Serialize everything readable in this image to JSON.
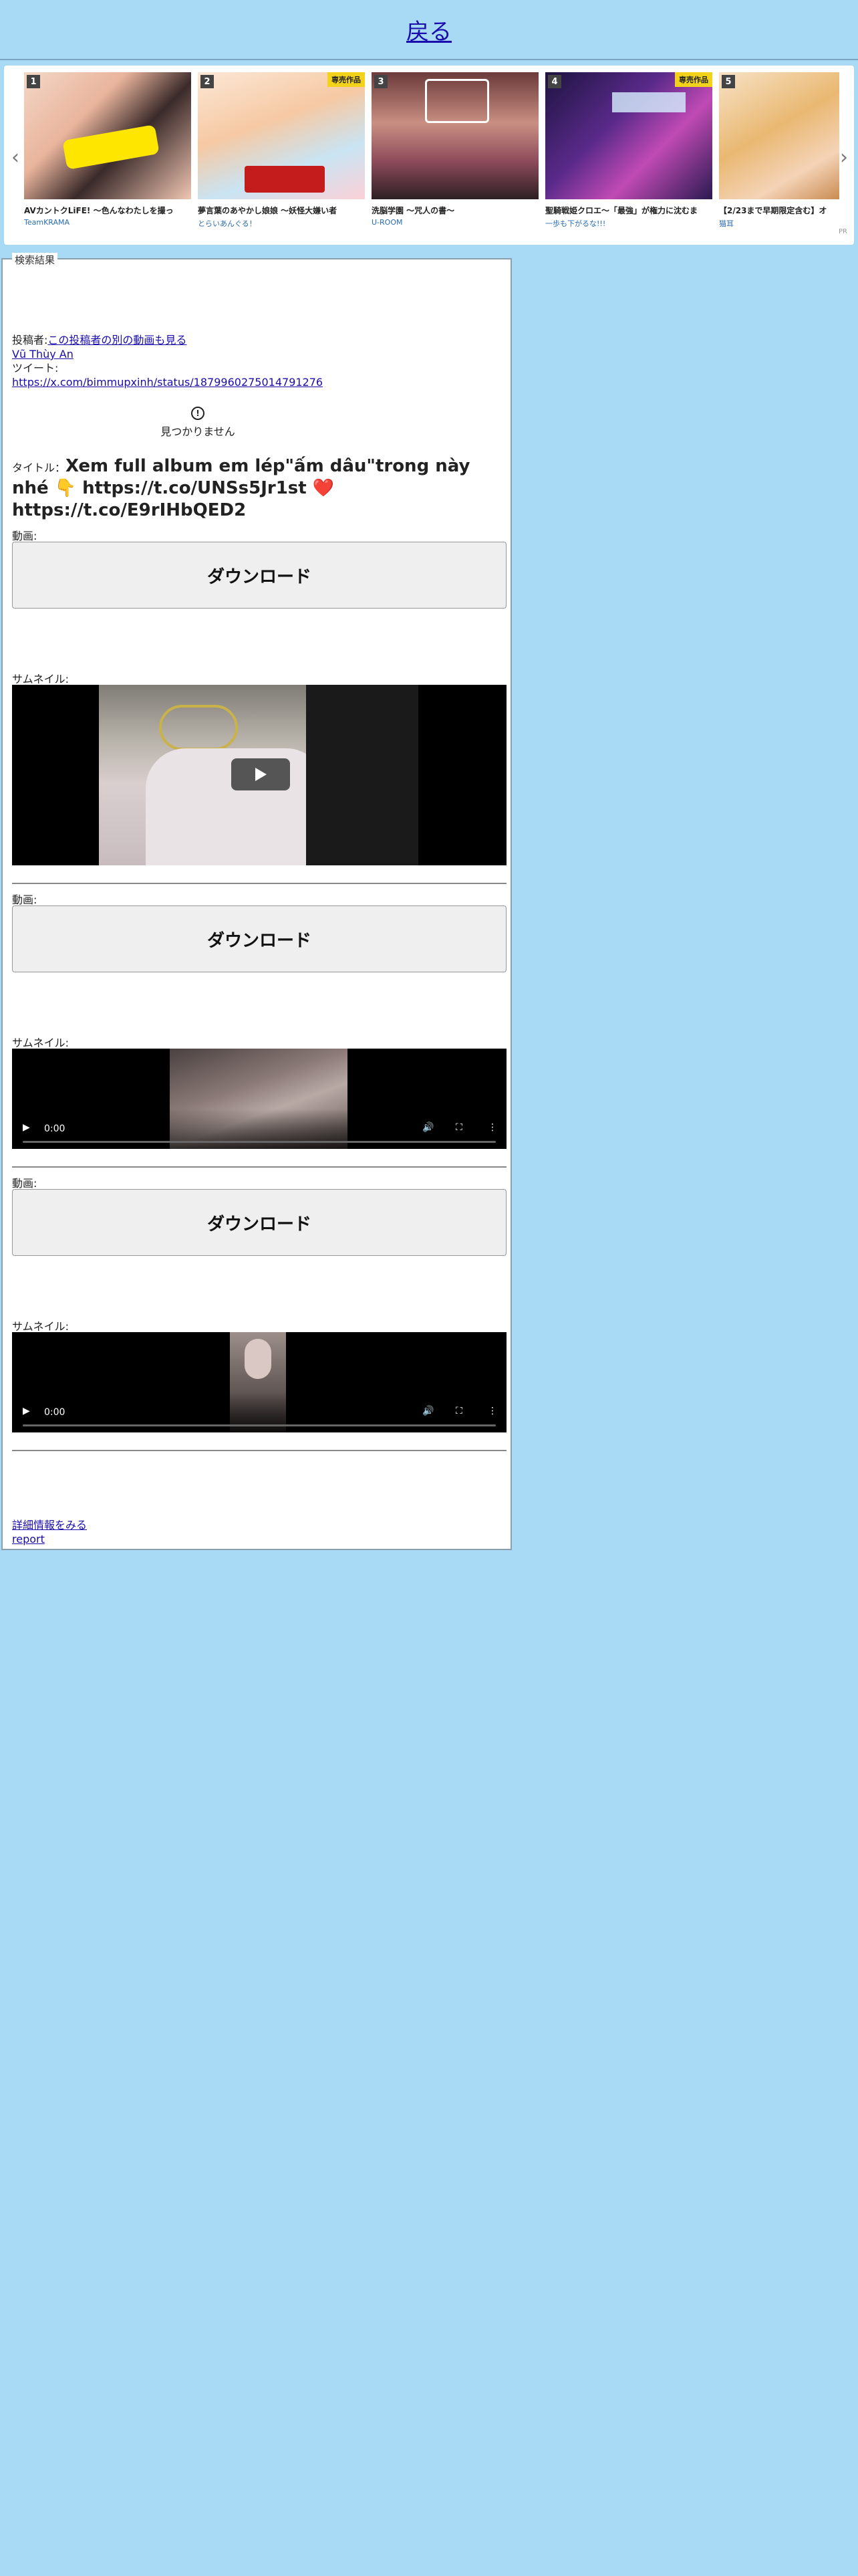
{
  "header": {
    "back_label": "戻る"
  },
  "carousel": {
    "pr_label": "PR",
    "items": [
      {
        "rank": "1",
        "badge": "",
        "title": "AVカントクLiFE! ～色んなわたしを撮っ",
        "circle": "TeamKRAMA"
      },
      {
        "rank": "2",
        "badge": "専売作品",
        "title": "夢言葉のあやかし娘娘 ～妖怪大嫌い者",
        "circle": "とらいあんぐる！"
      },
      {
        "rank": "3",
        "badge": "",
        "title": "洗脳学園 ～咒人の書～",
        "circle": "U-ROOM"
      },
      {
        "rank": "4",
        "badge": "専売作品",
        "title": "聖騎戦姫クロエ～「最強」が権力に沈むま",
        "circle": "一歩も下がるな!!!"
      },
      {
        "rank": "5",
        "badge": "",
        "title": "【2/23まで早期限定含む】オ",
        "circle": "猫耳"
      }
    ]
  },
  "result": {
    "legend": "検索結果",
    "poster_label": "投稿者:",
    "poster_link": "この投稿者の別の動画も見る",
    "poster_name": "Vũ Thùy An",
    "tweet_label": "ツイート:",
    "tweet_url": "https://x.com/bimmupxinh/status/1879960275014791276",
    "not_found": "見つかりません",
    "title_label": "タイトル：",
    "title_text": "Xem full album em lép\"ấm dâu\"trong này nhé 👇 https://t.co/UNSs5Jr1st ❤️ https://t.co/E9rIHbQED2",
    "videos": [
      {
        "video_label": "動画:",
        "download_label": "ダウンロード",
        "thumb_label": "サムネイル:"
      },
      {
        "video_label": "動画:",
        "download_label": "ダウンロード",
        "thumb_label": "サムネイル:",
        "time": "0:00"
      },
      {
        "video_label": "動画:",
        "download_label": "ダウンロード",
        "thumb_label": "サムネイル:",
        "time": "0:00"
      }
    ],
    "details_link": "詳細情報をみる",
    "report_link": "report"
  }
}
